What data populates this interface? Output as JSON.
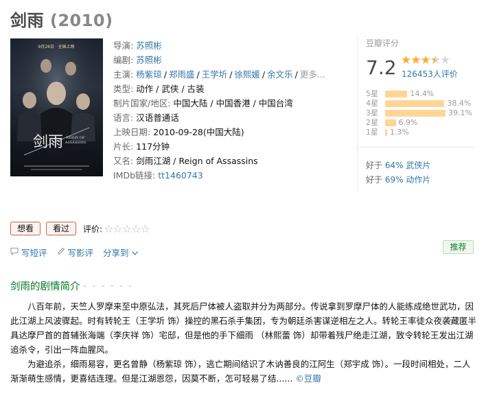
{
  "page": {
    "title": "剑雨",
    "year": "(2010)"
  },
  "info": {
    "director_label": "导演:",
    "director": "苏照彬",
    "writer_label": "编剧:",
    "writer": "苏照彬",
    "cast_label": "主演:",
    "cast": [
      "杨紫琼",
      "郑雨盛",
      "王学圻",
      "徐熙媛",
      "余文乐"
    ],
    "cast_more": "更多...",
    "genre_label": "类型:",
    "genre": "动作 / 武侠 / 古装",
    "country_label": "制片国家/地区:",
    "country": "中国大陆 / 中国香港 / 中国台湾",
    "language_label": "语言:",
    "language": "汉语普通话",
    "release_label": "上映日期:",
    "release": "2010-09-28(中国大陆)",
    "runtime_label": "片长:",
    "runtime": "117分钟",
    "aka_label": "又名:",
    "aka": "剑雨江湖 / Reign of Assassins",
    "imdb_label": "IMDb链接:",
    "imdb": "tt1460743"
  },
  "poster": {
    "top_text": "9月28日 · 全国上映",
    "title_cn": "剑雨",
    "title_en_1": "REIGN OF",
    "title_en_2": "ASSASSINS"
  },
  "rating": {
    "title": "豆瓣评分",
    "score": "7.2",
    "stars": 3.5,
    "votes": "126453人评价",
    "distribution": [
      {
        "label": "5星",
        "pct": "14.4%",
        "value": 14.4
      },
      {
        "label": "4星",
        "pct": "38.4%",
        "value": 38.4
      },
      {
        "label": "3星",
        "pct": "39.1%",
        "value": 39.1
      },
      {
        "label": "2星",
        "pct": "6.9%",
        "value": 6.9
      },
      {
        "label": "1星",
        "pct": "1.3%",
        "value": 1.3
      }
    ],
    "better_than": [
      {
        "prefix": "好于",
        "pct": "64%",
        "genre": "武侠片"
      },
      {
        "prefix": "好于",
        "pct": "69%",
        "genre": "动作片"
      }
    ]
  },
  "actions": {
    "want_label": "想看",
    "seen_label": "看过",
    "rate_label": "评价:"
  },
  "tools": {
    "short_review": "写短评",
    "review": "写影评",
    "share": "分享到",
    "recommend": "推荐"
  },
  "summary": {
    "title": "剑雨的剧情简介",
    "dots": "· · · · · ·",
    "para1": "八百年前，天竺人罗摩来至中原弘法，其死后尸体被人盗取并分为两部分。传说拿到罗摩尸体的人能练成绝世武功，因此江湖上风波骤起。时有转轮王（王学圻 饰）操控的黑石杀手集团，专为朝廷杀害谋逆相左之人。转轮王率徒众夜袭藏匿半具达摩尸首的首辅张海端（李庆祥 饰）宅邸，但是他的手下细雨 （林熙蕾 饰）却带着残尸绝走江湖，致令转轮王发出江湖追杀令，引出一阵血腥风。",
    "para2": "为避追杀，细雨易容，更名曾静（杨紫琼 饰），逃亡期间结识了木讷善良的江阿生（郑宇成 饰）。一段时间相处，二人渐渐萌生感情，更喜结连理。但是江湖恩怨，因莫不断，怎可轻易了结......",
    "source": "©豆瓣"
  }
}
